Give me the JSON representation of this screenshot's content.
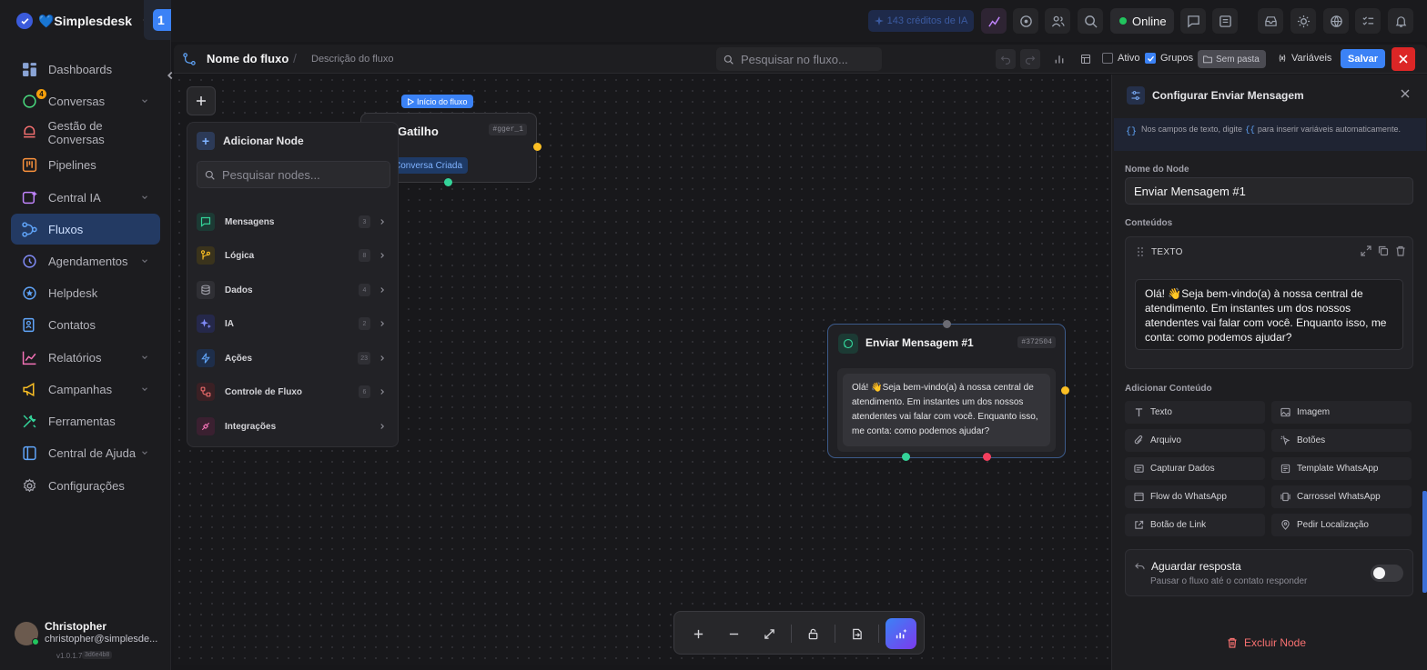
{
  "brand": {
    "name": "💙Simplesdesk",
    "workspace_badge": "1"
  },
  "sidebar": {
    "items": [
      {
        "label": "Dashboards",
        "icon": "dashboard-icon",
        "caret": false
      },
      {
        "label": "Conversas",
        "icon": "chat-icon",
        "caret": true,
        "badge": "4"
      },
      {
        "label": "Gestão de Conversas",
        "icon": "inbox-icon",
        "caret": false
      },
      {
        "label": "Pipelines",
        "icon": "kanban-icon",
        "caret": false
      },
      {
        "label": "Central IA",
        "icon": "ai-icon",
        "caret": true
      },
      {
        "label": "Fluxos",
        "icon": "flow-icon",
        "caret": false,
        "active": true
      },
      {
        "label": "Agendamentos",
        "icon": "calendar-icon",
        "caret": true
      },
      {
        "label": "Helpdesk",
        "icon": "helpdesk-icon",
        "caret": false
      },
      {
        "label": "Contatos",
        "icon": "contacts-icon",
        "caret": false
      },
      {
        "label": "Relatórios",
        "icon": "reports-icon",
        "caret": true
      },
      {
        "label": "Campanhas",
        "icon": "megaphone-icon",
        "caret": true
      },
      {
        "label": "Ferramentas",
        "icon": "tools-icon",
        "caret": false
      },
      {
        "label": "Central de Ajuda",
        "icon": "book-icon",
        "caret": true
      },
      {
        "label": "Configurações",
        "icon": "gear-icon",
        "caret": false
      }
    ]
  },
  "user": {
    "name": "Christopher",
    "email": "christopher@simplesde...",
    "version": "v1.0.1.7",
    "build": "3d6e4b8"
  },
  "topbar": {
    "ia_credits": "143 créditos de IA",
    "status": "Online"
  },
  "flow": {
    "name": "Nome do fluxo",
    "separator": "/",
    "description": "Descrição do fluxo",
    "search_placeholder": "Pesquisar no fluxo...",
    "ativo_label": "Ativo",
    "grupos_label": "Grupos",
    "sem_pasta_label": "Sem pasta",
    "variaveis_label": "Variáveis",
    "salvar_label": "Salvar"
  },
  "trigger_node": {
    "start_badge": "Início do fluxo",
    "title": "Gatilho",
    "id": "#gger_1",
    "chip": "Conversa Criada"
  },
  "node_menu": {
    "title": "Adicionar Node",
    "search_placeholder": "Pesquisar nodes...",
    "categories": [
      {
        "label": "Mensagens",
        "count": "3",
        "icon": "message-icon",
        "color": "#34d399"
      },
      {
        "label": "Lógica",
        "count": "8",
        "icon": "branch-icon",
        "color": "#fbbf24"
      },
      {
        "label": "Dados",
        "count": "4",
        "icon": "database-icon",
        "color": "#a1a1aa"
      },
      {
        "label": "IA",
        "count": "2",
        "icon": "sparkles-icon",
        "color": "#818cf8"
      },
      {
        "label": "Ações",
        "count": "23",
        "icon": "bolt-icon",
        "color": "#60a5fa"
      },
      {
        "label": "Controle de Fluxo",
        "count": "6",
        "icon": "route-icon",
        "color": "#f87171"
      },
      {
        "label": "Integrações",
        "count": "",
        "icon": "plug-icon",
        "color": "#f472b6"
      }
    ]
  },
  "message_node": {
    "title": "Enviar Mensagem #1",
    "id": "#372504",
    "text": "Olá! 👋Seja bem-vindo(a) à nossa central de atendimento. Em instantes um dos nossos atendentes vai falar com você. Enquanto isso, me conta: como podemos ajudar?"
  },
  "panel": {
    "title": "Configurar Enviar Mensagem",
    "tip_before": "Nos campos de texto, digite",
    "tip_code": "{{",
    "tip_after": "para inserir variáveis automaticamente.",
    "node_name_label": "Nome do Node",
    "node_name_value": "Enviar Mensagem #1",
    "contents_label": "Conteúdos",
    "content_type": "TEXTO",
    "content_text": "Olá! 👋Seja bem-vindo(a) à nossa central de atendimento. Em instantes um dos nossos atendentes vai falar com você. Enquanto isso, me conta: como podemos ajudar?",
    "add_content_label": "Adicionar Conteúdo",
    "add_buttons": [
      {
        "label": "Texto",
        "icon": "text-icon"
      },
      {
        "label": "Imagem",
        "icon": "image-icon"
      },
      {
        "label": "Arquivo",
        "icon": "paperclip-icon"
      },
      {
        "label": "Botões",
        "icon": "pointer-icon"
      },
      {
        "label": "Capturar Dados",
        "icon": "form-icon"
      },
      {
        "label": "Template WhatsApp",
        "icon": "template-icon"
      },
      {
        "label": "Flow do WhatsApp",
        "icon": "window-icon"
      },
      {
        "label": "Carrossel WhatsApp",
        "icon": "carousel-icon"
      },
      {
        "label": "Botão de Link",
        "icon": "external-link-icon"
      },
      {
        "label": "Pedir Localização",
        "icon": "map-pin-icon"
      }
    ],
    "wait_title": "Aguardar resposta",
    "wait_subtitle": "Pausar o fluxo até o contato responder",
    "wait_enabled": false,
    "delete_label": "Excluir Node"
  },
  "colors": {
    "accent": "#3b82f6",
    "active_nav": "#233a63",
    "danger": "#dc2626",
    "handle_yellow": "#fbbf24",
    "handle_green": "#34d399",
    "handle_red": "#f43f5e"
  }
}
